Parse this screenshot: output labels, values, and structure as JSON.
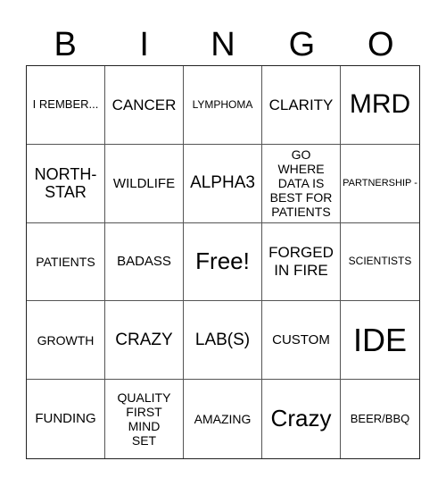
{
  "header": [
    "B",
    "I",
    "N",
    "G",
    "O"
  ],
  "cells": [
    "I REMBER...",
    "CANCER",
    "LYMPHOMA",
    "CLARITY",
    "MRD",
    "NORTH-STAR",
    "WILDLIFE",
    "ALPHA3",
    "GO WHERE DATA IS BEST FOR PATIENTS",
    "PARTNERSHIP -",
    "PATIENTS",
    "BADASS",
    "Free!",
    "FORGED IN FIRE",
    "SCIENTISTS",
    "GROWTH",
    "CRAZY",
    "LAB(S)",
    "CUSTOM",
    "IDE",
    "FUNDING",
    "QUALITY FIRST MIND SET",
    "AMAZING",
    "Crazy",
    "BEER/BBQ"
  ]
}
